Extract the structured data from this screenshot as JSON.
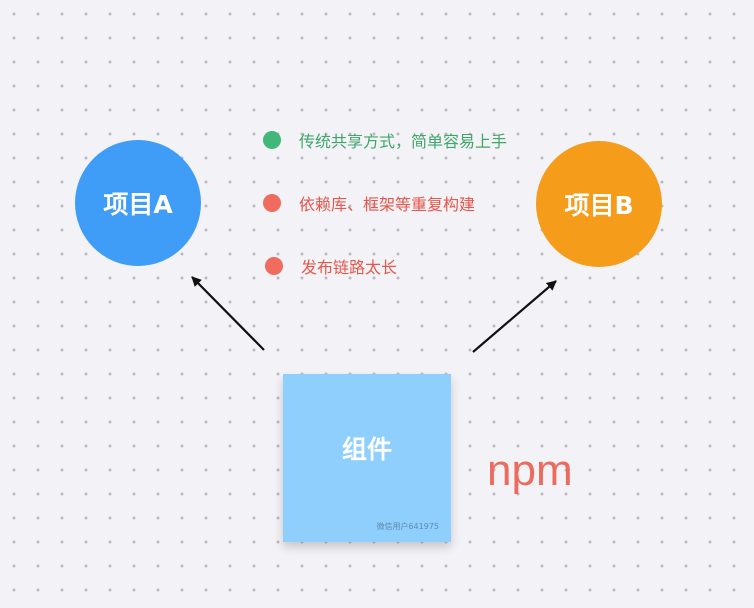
{
  "project_a": {
    "label": "项目A",
    "color": "#3f9cf7"
  },
  "project_b": {
    "label": "项目B",
    "color": "#f59c1b"
  },
  "notes": [
    {
      "text": "传统共享方式，简单容易上手",
      "color": "#3fa66a",
      "dot_color": "#41b877"
    },
    {
      "text": "依赖库、框架等重复构建",
      "color": "#e6584c",
      "dot_color": "#ef6c5e"
    },
    {
      "text": "发布链路太长",
      "color": "#e6584c",
      "dot_color": "#ef6c5e"
    }
  ],
  "component": {
    "label": "组件",
    "author": "微信用户641975",
    "color": "#8ecffd"
  },
  "npm_label": "npm"
}
